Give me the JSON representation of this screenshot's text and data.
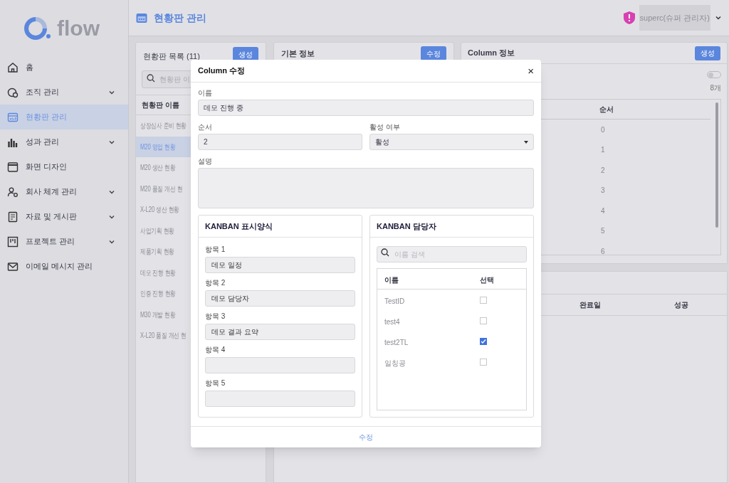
{
  "logo": {
    "text": "flow"
  },
  "sidebar": {
    "items": [
      {
        "label": "홈",
        "kind": "home",
        "expandable": false,
        "selected": false
      },
      {
        "label": "조직 관리",
        "kind": "org",
        "expandable": true,
        "selected": false
      },
      {
        "label": "현황판 관리",
        "kind": "board",
        "expandable": false,
        "selected": true
      },
      {
        "label": "성과 관리",
        "kind": "chart",
        "expandable": true,
        "selected": false
      },
      {
        "label": "화면 디자인",
        "kind": "window",
        "expandable": false,
        "selected": false
      },
      {
        "label": "회사 체계 관리",
        "kind": "people",
        "expandable": true,
        "selected": false
      },
      {
        "label": "자료 및 게시판",
        "kind": "doc",
        "expandable": true,
        "selected": false
      },
      {
        "label": "프로젝트 관리",
        "kind": "project",
        "expandable": true,
        "selected": false
      },
      {
        "label": "이메일 메시지 관리",
        "kind": "mail",
        "expandable": false,
        "selected": false
      }
    ]
  },
  "header": {
    "title": "현황판 관리",
    "user": "superc(슈퍼 관리자)"
  },
  "dashboard_list": {
    "title": "현황판 목록",
    "count": "(11)",
    "create_button": "생성",
    "search_placeholder": "현황판 이",
    "column": "현황판 이름",
    "items": [
      {
        "label": "상장심사 준비 현황",
        "selected": false
      },
      {
        "label": "M20 영업 현황",
        "selected": true
      },
      {
        "label": "M20 생산 현황",
        "selected": false
      },
      {
        "label": "M20 품질 개선 현",
        "selected": false
      },
      {
        "label": "X-L20 생산 현황",
        "selected": false
      },
      {
        "label": "사업기획 현황",
        "selected": false
      },
      {
        "label": "제품기획 현황",
        "selected": false
      },
      {
        "label": "데모 진행 현황",
        "selected": false
      },
      {
        "label": "인증 진행 현황",
        "selected": false
      },
      {
        "label": "M30 개발 현황",
        "selected": false
      },
      {
        "label": "X-L20 품질 개선 현",
        "selected": false
      }
    ]
  },
  "basic_info": {
    "title": "기본 정보",
    "edit_button": "수정"
  },
  "column_info": {
    "title": "Column 정보",
    "create_button": "생성",
    "toggle_on": false,
    "count": "8개",
    "column": "순서",
    "rows": [
      "0",
      "1",
      "2",
      "3",
      "4",
      "5",
      "6"
    ]
  },
  "history": {
    "columns": [
      "완료일",
      "성공"
    ]
  },
  "modal": {
    "title": "Column 수정",
    "close": "×",
    "name": {
      "label": "이름",
      "value": "데모 진행 중"
    },
    "order": {
      "label": "순서",
      "value": "2"
    },
    "active": {
      "label": "활성 여부",
      "value": "활성"
    },
    "description": {
      "label": "설명"
    },
    "display": {
      "title": "KANBAN 표시양식",
      "items": [
        {
          "label": "항목 1",
          "value": "데모 일정"
        },
        {
          "label": "항목 2",
          "value": "데모 담당자"
        },
        {
          "label": "항목 3",
          "value": "데모 결과 요약"
        },
        {
          "label": "항목 4"
        },
        {
          "label": "항목 5"
        }
      ]
    },
    "assignee": {
      "title": "KANBAN 담당자",
      "search_placeholder": "이름 검색",
      "columns": [
        "이름",
        "선택"
      ],
      "rows": [
        {
          "name": "TestID",
          "checked": false
        },
        {
          "name": "test4",
          "checked": false
        },
        {
          "name": "test2TL",
          "checked": true
        },
        {
          "name": "일칭공",
          "checked": false
        }
      ]
    },
    "submit": "수정"
  }
}
